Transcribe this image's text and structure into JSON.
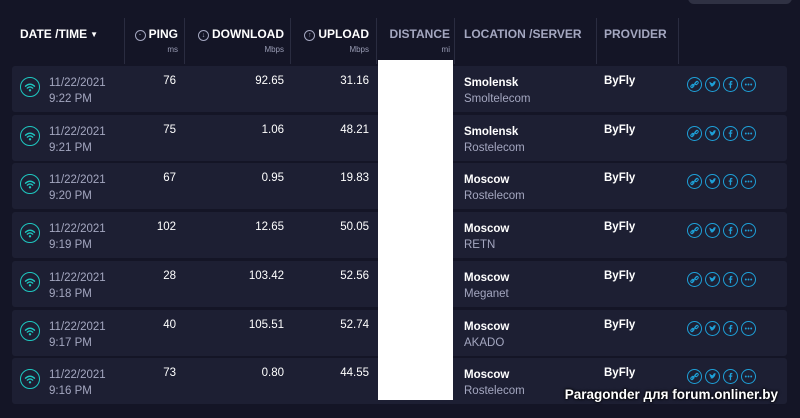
{
  "header": {
    "date_time": "DATE /TIME",
    "ping": "PING",
    "ping_unit": "ms",
    "download": "DOWNLOAD",
    "download_unit": "Mbps",
    "upload": "UPLOAD",
    "upload_unit": "Mbps",
    "distance": "DISTANCE",
    "distance_unit": "mi",
    "location_server": "LOCATION /SERVER",
    "provider": "PROVIDER"
  },
  "rows": [
    {
      "date": "11/22/2021",
      "time": "9:22 PM",
      "ping": "76",
      "download": "92.65",
      "upload": "31.16",
      "city": "Smolensk",
      "isp": "Smoltelecom",
      "provider": "ByFly"
    },
    {
      "date": "11/22/2021",
      "time": "9:21 PM",
      "ping": "75",
      "download": "1.06",
      "upload": "48.21",
      "city": "Smolensk",
      "isp": "Rostelecom",
      "provider": "ByFly"
    },
    {
      "date": "11/22/2021",
      "time": "9:20 PM",
      "ping": "67",
      "download": "0.95",
      "upload": "19.83",
      "city": "Moscow",
      "isp": "Rostelecom",
      "provider": "ByFly"
    },
    {
      "date": "11/22/2021",
      "time": "9:19 PM",
      "ping": "102",
      "download": "12.65",
      "upload": "50.05",
      "city": "Moscow",
      "isp": "RETN",
      "provider": "ByFly"
    },
    {
      "date": "11/22/2021",
      "time": "9:18 PM",
      "ping": "28",
      "download": "103.42",
      "upload": "52.56",
      "city": "Moscow",
      "isp": "Meganet",
      "provider": "ByFly"
    },
    {
      "date": "11/22/2021",
      "time": "9:17 PM",
      "ping": "40",
      "download": "105.51",
      "upload": "52.74",
      "city": "Moscow",
      "isp": "AKADO",
      "provider": "ByFly"
    },
    {
      "date": "11/22/2021",
      "time": "9:16 PM",
      "ping": "73",
      "download": "0.80",
      "upload": "44.55",
      "city": "Moscow",
      "isp": "Rostelecom",
      "provider": "ByFly"
    }
  ],
  "row_icons": [
    "wifi-icon",
    "link-icon",
    "twitter-icon",
    "facebook-icon",
    "more-icon"
  ],
  "watermark": "Paragonder для forum.onliner.by",
  "colors": {
    "background": "#141526",
    "row_background": "#1d1f33",
    "accent_teal": "#1ec7c0",
    "accent_blue": "#1ea0d8"
  }
}
